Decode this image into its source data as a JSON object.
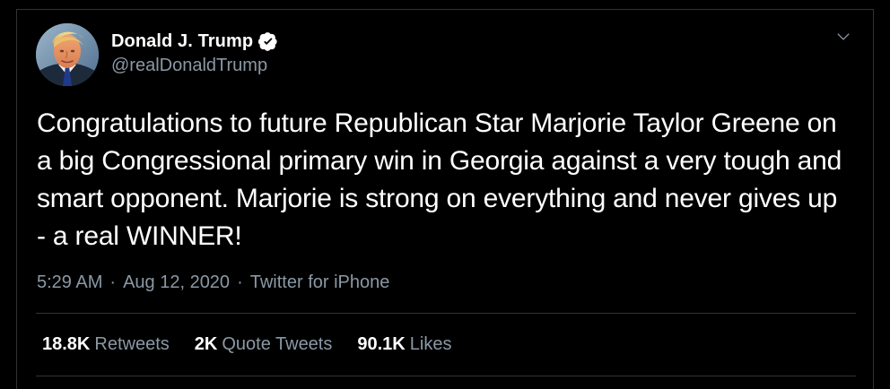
{
  "tweet": {
    "author": {
      "display_name": "Donald J. Trump",
      "handle": "@realDonaldTrump",
      "verified": true,
      "avatar_icon": "profile-avatar"
    },
    "menu_icon": "chevron-down-icon",
    "text": "Congratulations to future Republican Star Marjorie Taylor Greene on a big Congressional primary win in Georgia against a very tough and smart opponent. Marjorie is strong on everything and never gives up - a real WINNER!",
    "meta": {
      "time": "5:29 AM",
      "date": "Aug 12, 2020",
      "source": "Twitter for iPhone",
      "separator": "·"
    },
    "stats": [
      {
        "count": "18.8K",
        "label": "Retweets"
      },
      {
        "count": "2K",
        "label": "Quote Tweets"
      },
      {
        "count": "90.1K",
        "label": "Likes"
      }
    ]
  },
  "colors": {
    "background": "#000000",
    "primary_text": "#ffffff",
    "secondary_text": "#8b98a5",
    "border": "#2f3336",
    "verified_badge": "#ffffff",
    "verified_check": "#000000"
  }
}
